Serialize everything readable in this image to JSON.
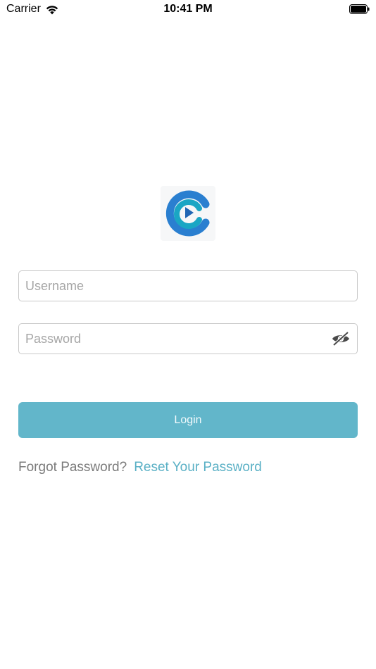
{
  "status_bar": {
    "carrier": "Carrier",
    "time": "10:41 PM",
    "icons": [
      "wifi-icon",
      "battery-icon"
    ]
  },
  "logo": {
    "icon": "app-logo-c-play",
    "colors": {
      "outer": "#2a7fd0",
      "inner": "#1aa6c4",
      "play": "#2066b4"
    }
  },
  "form": {
    "username": {
      "placeholder": "Username",
      "value": ""
    },
    "password": {
      "placeholder": "Password",
      "value": "",
      "toggle_icon": "eye-slash-icon"
    },
    "login_label": "Login"
  },
  "forgot": {
    "prompt": "Forgot Password?",
    "link": "Reset Your Password"
  },
  "colors": {
    "accent": "#62b6ca",
    "link": "#5ab0c5",
    "border": "#c8c8c8",
    "muted_text": "#7b7b7b"
  }
}
